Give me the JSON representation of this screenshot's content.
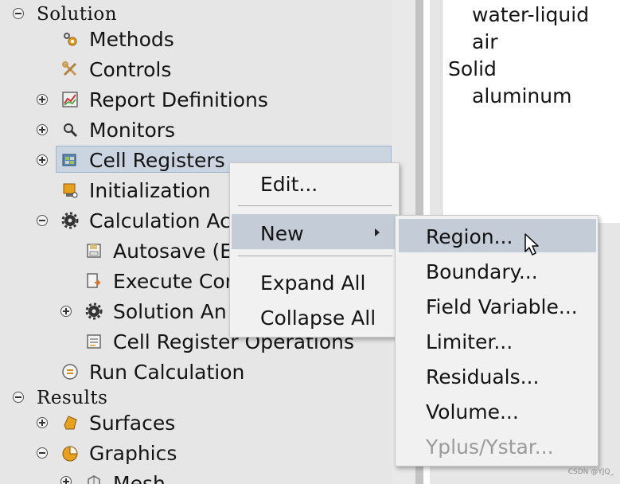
{
  "tree": {
    "solution": "Solution",
    "methods": "Methods",
    "controls": "Controls",
    "report_definitions": "Report Definitions",
    "monitors": "Monitors",
    "cell_registers": "Cell Registers",
    "initialization": "Initialization",
    "calculation_activities": "Calculation Ac",
    "autosave": "Autosave (E",
    "execute_commands": "Execute Cor",
    "solution_animations": "Solution An",
    "cell_register_operations": "Cell Register Operations",
    "run_calculation": "Run Calculation",
    "results": "Results",
    "surfaces": "Surfaces",
    "graphics": "Graphics",
    "mesh": "Mesh"
  },
  "right_panel": {
    "items": [
      "water-liquid",
      "air",
      "Solid",
      "aluminum"
    ]
  },
  "context_menu": {
    "edit": "Edit...",
    "new": "New",
    "expand_all": "Expand All",
    "collapse_all": "Collapse All"
  },
  "submenu": {
    "items": [
      "Region...",
      "Boundary...",
      "Field Variable...",
      "Limiter...",
      "Residuals...",
      "Volume...",
      "Yplus/Ystar..."
    ],
    "disabled": "Yplus/Ystar...",
    "highlighted": "Region..."
  },
  "watermark": "CSDN @YJQ_",
  "colors": {
    "tree_bg": "#e6e6e6",
    "selection": "#cbd5e1",
    "menu_bg": "#f1f1f1",
    "menu_highlight": "#c4ccd8",
    "disabled_text": "#9a9a9a"
  }
}
